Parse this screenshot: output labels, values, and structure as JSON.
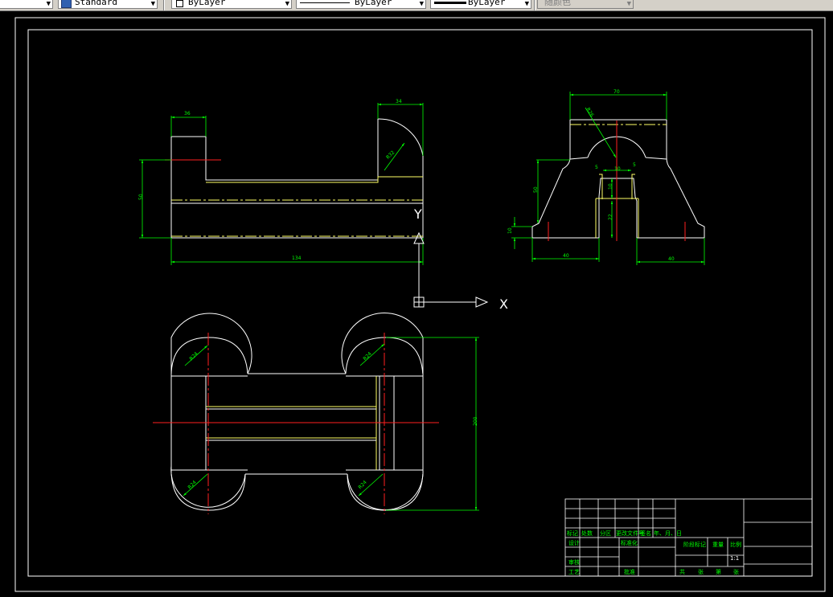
{
  "toolbar": {
    "text_style": "Standard",
    "layer_color": "ByLayer",
    "linetype": "ByLayer",
    "lineweight": "ByLayer",
    "plot_style": "随颜色"
  },
  "ucs": {
    "x_label": "X",
    "y_label": "Y"
  },
  "dimensions": {
    "front_top_left_width": "36",
    "front_top_right_width": "34",
    "front_radius": "R32",
    "front_height": "50",
    "front_length": "134",
    "side_top_width": "70",
    "side_radius": "R26",
    "side_small_left": "5",
    "side_small_right": "5",
    "side_slot_width": "10",
    "side_height_left": "50",
    "side_base_thick": "10",
    "side_slot_depth": "10",
    "side_slot_height": "22",
    "side_left_width": "40",
    "side_right_width": "40",
    "top_radius_tl": "R24",
    "top_radius_tr": "R24",
    "top_radius_bl": "R24",
    "top_radius_br": "R24",
    "top_height": "200"
  },
  "title_block": {
    "row_labels": [
      "标记",
      "处数",
      "分区",
      "更改文件号",
      "签名",
      "年、月、日"
    ],
    "design": "设计",
    "standardization": "标准化",
    "stage_mark": "阶段标记",
    "weight": "重量",
    "scale": "比例",
    "scale_value": "1:1",
    "review": "审核",
    "process": "工艺",
    "approve": "批准",
    "sheet_info": [
      "共",
      "张",
      "第",
      "张"
    ]
  }
}
